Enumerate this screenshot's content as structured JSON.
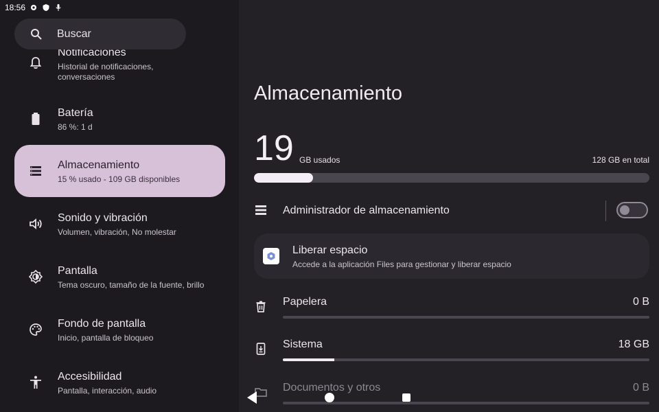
{
  "status_bar": {
    "time": "18:56"
  },
  "search": {
    "placeholder": "Buscar"
  },
  "sidebar": {
    "items": [
      {
        "title": "Notificaciones",
        "subtitle": "Historial de notificaciones, conversaciones",
        "icon": "bell-icon"
      },
      {
        "title": "Batería",
        "subtitle": "86 %: 1 d",
        "icon": "battery-icon"
      },
      {
        "title": "Almacenamiento",
        "subtitle": "15 % usado - 109 GB disponibles",
        "icon": "storage-icon",
        "selected": true
      },
      {
        "title": "Sonido y vibración",
        "subtitle": "Volumen, vibración, No molestar",
        "icon": "volume-icon"
      },
      {
        "title": "Pantalla",
        "subtitle": "Tema oscuro, tamaño de la fuente, brillo",
        "icon": "brightness-icon"
      },
      {
        "title": "Fondo de pantalla",
        "subtitle": "Inicio, pantalla de bloqueo",
        "icon": "palette-icon"
      },
      {
        "title": "Accesibilidad",
        "subtitle": "Pantalla, interacción, audio",
        "icon": "accessibility-icon"
      }
    ]
  },
  "main": {
    "title": "Almacenamiento",
    "used_value": "19",
    "used_unit": "GB usados",
    "total": "128 GB en total",
    "usage_fraction": 0.15,
    "manager": {
      "label": "Administrador de almacenamiento",
      "enabled": false
    },
    "free_space": {
      "title": "Liberar espacio",
      "subtitle": "Accede a la aplicación Files para gestionar y liberar espacio"
    },
    "categories": [
      {
        "name": "Papelera",
        "value": "0 B",
        "fraction": 0.0,
        "icon": "trash-icon"
      },
      {
        "name": "Sistema",
        "value": "18 GB",
        "fraction": 0.14,
        "icon": "system-icon"
      },
      {
        "name": "Documentos y otros",
        "value": "0 B",
        "fraction": 0.0,
        "icon": "folder-icon"
      }
    ]
  },
  "colors": {
    "selected_item": "#d7c1d9",
    "background": "#1c1a1f",
    "pane": "#232026"
  }
}
